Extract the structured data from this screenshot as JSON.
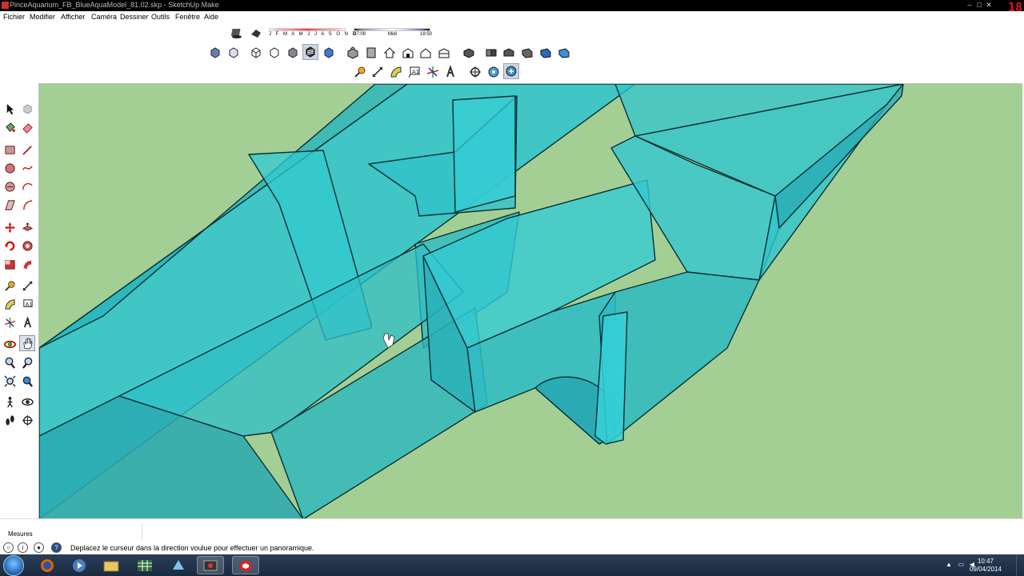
{
  "window": {
    "title": "PinceAquarium_FB_BlueAquaModel_81.02.skp - SketchUp Make",
    "recording_badge": "18",
    "controls": [
      "–",
      "□",
      "✕"
    ]
  },
  "menu": {
    "items": [
      "Fichier",
      "Modifier",
      "Afficher",
      "Caméra",
      "Dessiner",
      "Outils",
      "Fenêtre",
      "Aide"
    ]
  },
  "shadows": {
    "months": "J F M A M J J A S O N D",
    "time_start": "07:09",
    "time_mid": "Midi",
    "time_end": "18:50"
  },
  "toolbar_top_icons": [
    "shadows-toggle-icon",
    "fog-toggle-icon"
  ],
  "toolbar_views_icons": [
    "iso-view-icon",
    "top-view-icon",
    "front-view-icon",
    "right-view-icon",
    "back-view-icon",
    "left-view-icon",
    "xray-icon",
    "back-edges-icon",
    "wireframe-icon",
    "hidden-line-icon",
    "shaded-icon",
    "shaded-textures-icon",
    "monochrome-icon",
    "house-icon",
    "house-2-icon",
    "warehouse-icon",
    "component-icon",
    "share-model-icon"
  ],
  "toolbar_tools_icons": [
    "tape-measure-icon",
    "dimension-icon",
    "protractor-icon",
    "text-icon",
    "axes-icon",
    "3d-text-icon",
    "position-camera-icon",
    "look-around-icon",
    "walk-icon"
  ],
  "left_tools": [
    "select-icon",
    "make-component-icon",
    "paint-bucket-icon",
    "eraser-icon",
    "rectangle-icon",
    "line-icon",
    "circle-icon",
    "arc-icon",
    "polygon-icon",
    "freehand-icon",
    "move-icon",
    "push-pull-icon",
    "rotate-icon",
    "follow-me-icon",
    "scale-icon",
    "offset-icon",
    "tape-measure-icon",
    "dimension-icon",
    "protractor-icon",
    "text-icon",
    "axes-icon",
    "3d-text-icon",
    "orbit-icon",
    "pan-icon",
    "zoom-icon",
    "zoom-window-icon",
    "zoom-extents-icon",
    "previous-view-icon",
    "position-camera-icon",
    "look-around-icon",
    "walk-icon",
    "section-plane-icon"
  ],
  "measures": {
    "label": "Mesures",
    "value": ""
  },
  "status": {
    "text": "Deplacez le curseur dans la direction voulue pour effectuer un panoramique.",
    "icons": [
      "geo-location-icon",
      "credits-icon",
      "user-icon",
      "help-icon"
    ]
  },
  "taskbar": {
    "apps": [
      "internet-explorer-icon",
      "firefox-icon",
      "media-player-icon",
      "explorer-icon",
      "spreadsheet-icon",
      "app-icon",
      "recorder-icon",
      "sketchup-icon"
    ],
    "time": "10:47",
    "date": "09/04/2014"
  },
  "colors": {
    "viewport_ground": "#a4cf94",
    "model_fill": "#2fc4cc",
    "model_edge": "#0a2f34",
    "taskbar": "#1e3048"
  }
}
